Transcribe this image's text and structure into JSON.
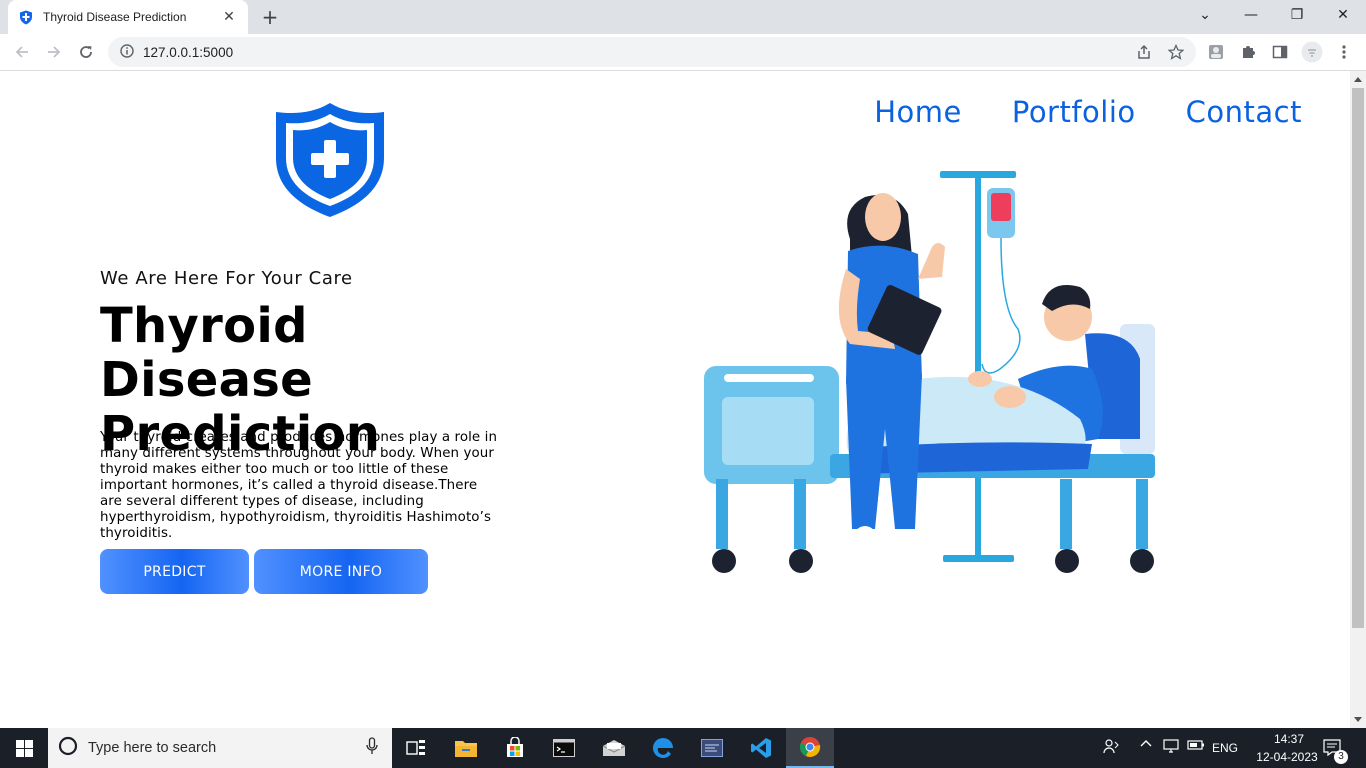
{
  "browser": {
    "tab_title": "Thyroid Disease Prediction",
    "tab_close": "✕",
    "new_tab": "+",
    "url": "127.0.0.1:5000",
    "window_controls": {
      "dropdown": "⌄",
      "minimize": "—",
      "restore": "❐",
      "close": "✕"
    }
  },
  "page": {
    "nav": {
      "home": "Home",
      "portfolio": "Portfolio",
      "contact": "Contact"
    },
    "subtitle": "We Are Here For Your Care",
    "title": "Thyroid Disease Prediction",
    "description": "Your thyroid creates and produces hormones play a role in many different systems throughout your body. When your thyroid makes either too much or too little of these important hormones, it’s called a thyroid disease.There are several different types of disease, including hyperthyroidism, hypothyroidism, thyroiditis Hashimoto’s thyroiditis.",
    "buttons": {
      "predict": "PREDICT",
      "more_info": "MORE INFO"
    }
  },
  "taskbar": {
    "search_placeholder": "Type here to search",
    "language": "ENG",
    "time": "14:37",
    "date": "12-04-2023",
    "notification_count": "3"
  },
  "colors": {
    "brand_blue": "#0b62e0",
    "button_gradient_start": "#5191ff",
    "button_gradient_mid": "#1565f2"
  }
}
